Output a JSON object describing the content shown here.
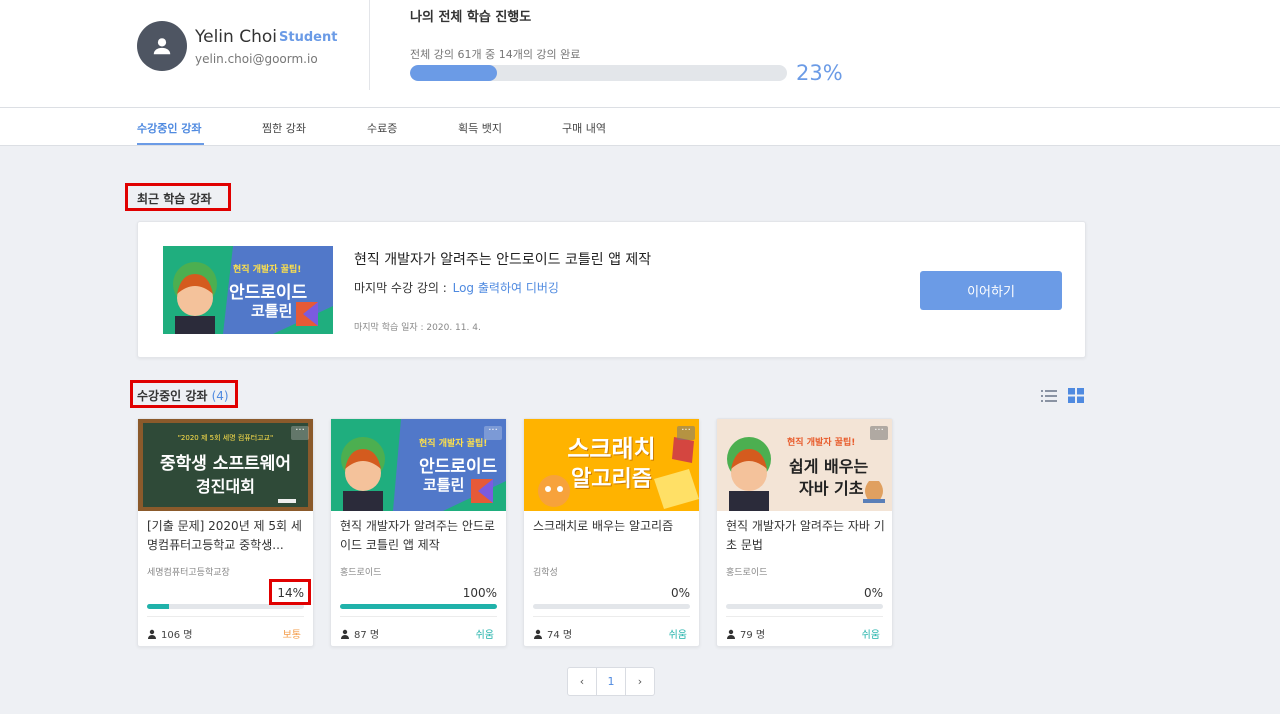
{
  "profile": {
    "name": "Yelin Choi",
    "role": "Student",
    "email": "yelin.choi@goorm.io"
  },
  "overall_progress": {
    "title": "나의 전체 학습 진행도",
    "subtitle": "전체 강의 61개 중 14개의 강의 완료",
    "percent_label": "23%",
    "fraction": 0.23
  },
  "tabs": [
    {
      "label": "수강중인 강좌",
      "active": true
    },
    {
      "label": "찜한 강좌",
      "active": false
    },
    {
      "label": "수료증",
      "active": false
    },
    {
      "label": "획득 뱃지",
      "active": false
    },
    {
      "label": "구매 내역",
      "active": false
    }
  ],
  "recent": {
    "section_title": "최근 학습 강좌",
    "course_title": "현직 개발자가 알려주는 안드로이드 코틀린 앱 제작",
    "last_lecture_label": "마지막 수강 강의 :",
    "last_lecture_link": "Log 출력하여 디버깅",
    "last_date": "마지막 학습 일자 : 2020. 11. 4.",
    "continue_label": "이어하기",
    "thumb": {
      "top": "현직 개발자 꿀팁!",
      "line1": "안드로이드",
      "line2": "코틀린"
    }
  },
  "enrolled": {
    "section_title": "수강중인 강좌",
    "count": "(4)"
  },
  "courses": [
    {
      "title": "[기출 문제] 2020년 제 5회 세명컴퓨터고등학교 중학생...",
      "teacher": "세명컴퓨터고등학교장",
      "progress_label": "14%",
      "progress": 0.14,
      "students": "106 명",
      "level": "보통",
      "level_color": "#f39c4a",
      "thumb": {
        "top": "\"2020 제 5회 세명 컴퓨터고교\"",
        "line1": "중학생 소프트웨어",
        "line2": "경진대회"
      }
    },
    {
      "title": "현직 개발자가 알려주는 안드로이드 코틀린 앱 제작",
      "teacher": "홍드로이드",
      "progress_label": "100%",
      "progress": 1.0,
      "students": "87 명",
      "level": "쉬움",
      "level_color": "#20b2aa",
      "thumb": {
        "top": "현직 개발자 꿀팁!",
        "line1": "안드로이드",
        "line2": "코틀린"
      }
    },
    {
      "title": "스크래치로 배우는 알고리즘",
      "teacher": "김학성",
      "progress_label": "0%",
      "progress": 0,
      "students": "74 명",
      "level": "쉬움",
      "level_color": "#20b2aa",
      "thumb": {
        "line1": "스크래치",
        "line2": "알고리즘"
      }
    },
    {
      "title": "현직 개발자가 알려주는 자바 기초 문법",
      "teacher": "홍드로이드",
      "progress_label": "0%",
      "progress": 0,
      "students": "79 명",
      "level": "쉬움",
      "level_color": "#20b2aa",
      "thumb": {
        "top": "현직 개발자 꿀팁!",
        "line1": "쉽게 배우는",
        "line2": "자바 기초"
      }
    }
  ],
  "pagination": {
    "prev": "‹",
    "current": "1",
    "next": "›"
  },
  "colors": {
    "accent": "#6b9be6",
    "progress_teal": "#20b2aa",
    "highlight_red": "#e00000"
  }
}
